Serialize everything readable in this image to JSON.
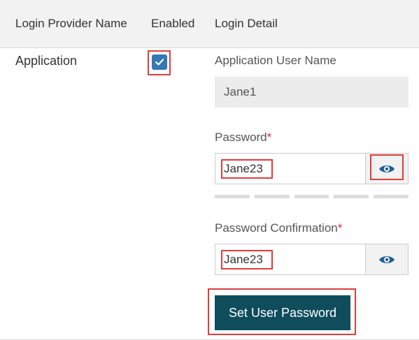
{
  "table": {
    "headers": [
      "Login Provider Name",
      "Enabled",
      "Login Detail"
    ],
    "row": {
      "provider_name": "Application",
      "enabled": true
    }
  },
  "login_detail": {
    "username_label": "Application User Name",
    "username_value": "Jane1",
    "password_label": "Password",
    "password_required_marker": "*",
    "password_value": "Jane23",
    "password_confirm_label": "Password Confirmation",
    "password_confirm_required_marker": "*",
    "password_confirm_value": "Jane23",
    "submit_label": "Set User Password"
  },
  "colors": {
    "accent": "#3478b6",
    "primary_button": "#0f4c5c",
    "highlight": "#e03c3c",
    "required": "#d32f2f",
    "eye_icon": "#1f5f9b"
  },
  "icons": {
    "checkbox": "check-icon",
    "show_password": "eye-icon",
    "show_password_confirm": "eye-icon"
  }
}
